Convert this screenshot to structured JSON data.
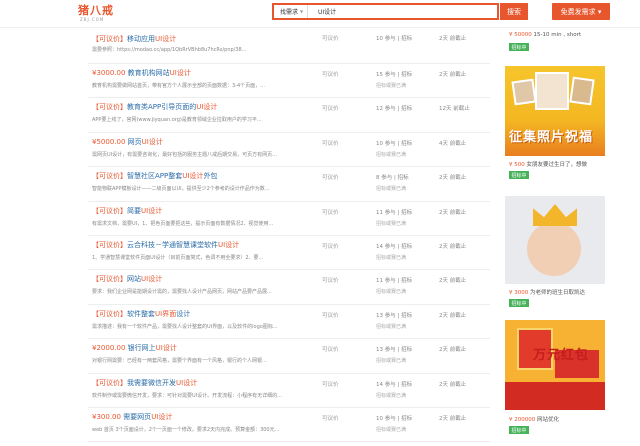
{
  "header": {
    "logo_text": "猪八戒",
    "logo_sub": "ZBJ.COM",
    "search_category": "找需求",
    "search_value": "UI设计",
    "search_button": "搜索",
    "post_button": "免费发需求 ▾"
  },
  "list": [
    {
      "tag": "【可议价】",
      "price": "",
      "name_pre": "移动应用",
      "name_hl": "UI设计",
      "name_post": "",
      "desc": "需要参照：https://modao.cc/app/1QbRrVBhb8u7hcRs/pnp/38...",
      "mode": "可议价",
      "stat": "10 参与 | 招标",
      "stat2": "",
      "time": "2天 前截止"
    },
    {
      "tag": "",
      "price": "¥3000.00",
      "name_pre": "教育机构网站",
      "name_hl": "UI设计",
      "name_post": "",
      "desc": "教育机构需要做网站首页，带有官方个人展示全部的页面数据：3-4个页面，...",
      "mode": "可议价",
      "stat": "15 参与 | 招标",
      "stat2": "招标或赛已满",
      "time": "2天 前截止"
    },
    {
      "tag": "【可议价】",
      "price": "",
      "name_pre": "教育类APP引导页面的",
      "name_hl": "UI设计",
      "name_post": "",
      "desc": "APP要上线了，官网(www.jiyquan.org)是教育领域企业拉取用户的学习平...",
      "mode": "可议价",
      "stat": "12 参与 | 招标",
      "stat2": "",
      "time": "12天 前截止"
    },
    {
      "tag": "",
      "price": "¥5000.00",
      "name_pre": "网页",
      "name_hl": "UI设计",
      "name_post": "",
      "desc": "需网页UI设计，有需要咨询化，最好包括的服务主题八戒后期交易，可页方有网页...",
      "mode": "可议价",
      "stat": "10 参与 | 招标",
      "stat2": "招标或赛已满",
      "time": "4天 前截止"
    },
    {
      "tag": "【可议价】",
      "price": "",
      "name_pre": "智慧社区APP整套",
      "name_hl": "UI设计",
      "name_post": "外包",
      "desc": "智能物联APP模板设计——二级页面以UI，提供至少2个参考的设计作品作为数...",
      "mode": "可议价",
      "stat": "8 参与 | 招标",
      "stat2": "招标或赛已满",
      "time": "2天 前截止"
    },
    {
      "tag": "【可议价】",
      "price": "",
      "name_pre": "简要",
      "name_hl": "UI设计",
      "name_post": "",
      "desc": "有需求文档，需要UI，1、把色页面要把这些，提示页面有数据情况2、视觉使用...",
      "mode": "可议价",
      "stat": "11 参与 | 招标",
      "stat2": "招标或赛已满",
      "time": "2天 前截止"
    },
    {
      "tag": "【可议价】",
      "price": "",
      "name_pre": "云合科技－学通智慧课堂软件",
      "name_hl": "UI设计",
      "name_post": "",
      "desc": "1、学通智慧课堂软件页面UI设计（目前页面简式，色调不用全要求）2、要...",
      "mode": "可议价",
      "stat": "14 参与 | 招标",
      "stat2": "招标或赛已满",
      "time": "2天 前截止"
    },
    {
      "tag": "【可议价】",
      "price": "",
      "name_pre": "网站",
      "name_hl": "UI设计",
      "name_post": "",
      "desc": "要求：我们企业网是能期设计需的，需要找人设计产品网页，网站产品要产品展...",
      "mode": "可议价",
      "stat": "11 参与 | 招标",
      "stat2": "招标或赛已满",
      "time": "2天 前截止"
    },
    {
      "tag": "【可议价】",
      "price": "",
      "name_pre": "软件整套",
      "name_hl": "UI界面",
      "name_post": "设计",
      "desc": "需求描述：我有一个软件产品，需要找人设计整套的UI界面，以及软件的logo图标...",
      "mode": "可议价",
      "stat": "13 参与 | 招标",
      "stat2": "招标或赛已满",
      "time": "2天 前截止"
    },
    {
      "tag": "",
      "price": "¥2000.00",
      "name_pre": "银行网上",
      "name_hl": "UI设计",
      "name_post": "",
      "desc": "对银行网需要：已经有一两套风格，需要个界面有一个风格，银行的个人网银...",
      "mode": "可议价",
      "stat": "13 参与 | 招标",
      "stat2": "招标或赛已满",
      "time": "2天 前截止"
    },
    {
      "tag": "【可议价】",
      "price": "",
      "name_pre": "我需要微信开发",
      "name_hl": "UI设计",
      "name_post": "",
      "desc": "软件制作或需要微信开发，要求：可针对需要UI设计。开发流程：小程序有无详细的...",
      "mode": "可议价",
      "stat": "14 参与 | 招标",
      "stat2": "招标或赛已满",
      "time": "2天 前截止"
    },
    {
      "tag": "",
      "price": "¥300.00",
      "name_pre": "需要网页",
      "name_hl": "UI设计",
      "name_post": "",
      "desc": "web 首页 3个页面设计，2个一页面一个修改。要求2天内完成。预算金额：300元...",
      "mode": "可议价",
      "stat": "10 参与 | 招标",
      "stat2": "招标或赛已满",
      "time": "2天 前截止"
    }
  ],
  "sidebar": {
    "cards": [
      {
        "price": "¥ 50000",
        "title": "15-10 min , short",
        "badge": "招标中"
      },
      {
        "price": "¥ 500",
        "title": "女朋友要过生日了，想做",
        "badge": "招标中",
        "banner_text": "征集照片祝福"
      },
      {
        "price": "¥ 3000",
        "title": "为老师的班生日取凯达",
        "badge": "招标中"
      },
      {
        "price": "¥ 200000",
        "title": "网站优化",
        "badge": "招标中",
        "banner_text": "万元红包"
      }
    ]
  },
  "colors": {
    "accent": "#e8562e",
    "link": "#2a6ca8",
    "badge": "#47b25a"
  }
}
